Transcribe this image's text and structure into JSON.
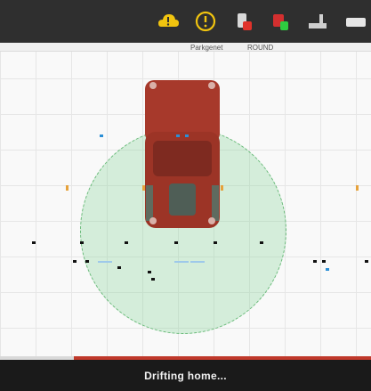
{
  "toolbar": {
    "icons": [
      "warning-cloud-icon",
      "alert-circle-icon",
      "car-red-icon",
      "car-green-icon",
      "sensor-icon",
      "toggle-icon"
    ]
  },
  "ruler": {
    "left_label": "Parkgenet",
    "right_label": "ROUND"
  },
  "status": {
    "message": "Drifting home...",
    "progress": 0.8
  },
  "colors": {
    "toolbar": "#2f2f2f",
    "car_body": "#a7392b",
    "radar": "#78d28c",
    "status_bar": "#1a1a1a",
    "progress": "#c0392b"
  }
}
